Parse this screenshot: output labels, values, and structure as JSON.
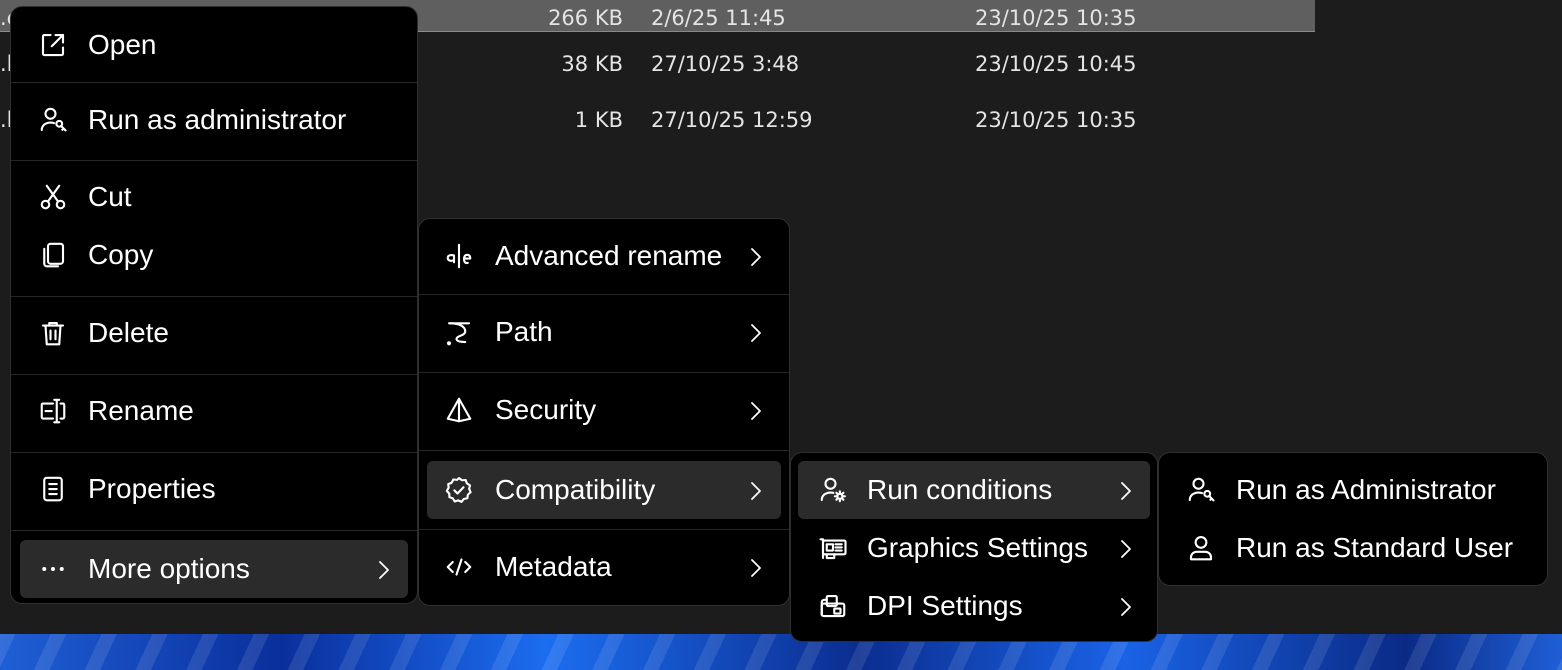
{
  "file_list": {
    "rows": [
      {
        "name": ".exe",
        "size": "266 KB",
        "modified": "2/6/25 11:45",
        "created": "23/10/25 10:35",
        "selected": true
      },
      {
        "name": ".l",
        "size": "38 KB",
        "modified": "27/10/25 3:48",
        "created": "23/10/25 10:45",
        "selected": false
      },
      {
        "name": ".l",
        "size": "1 KB",
        "modified": "27/10/25 12:59",
        "created": "23/10/25 10:35",
        "selected": false
      }
    ]
  },
  "context_menu": {
    "items": [
      {
        "label": "Open",
        "icon": "open-external-icon"
      },
      {
        "label": "Run as administrator",
        "icon": "user-key-icon"
      },
      {
        "label": "Cut",
        "icon": "scissors-icon"
      },
      {
        "label": "Copy",
        "icon": "copy-icon"
      },
      {
        "label": "Delete",
        "icon": "trash-icon"
      },
      {
        "label": "Rename",
        "icon": "rename-icon"
      },
      {
        "label": "Properties",
        "icon": "properties-icon"
      },
      {
        "label": "More options",
        "icon": "more-horizontal-icon",
        "submenu": true,
        "highlighted": true
      }
    ]
  },
  "more_options_menu": {
    "items": [
      {
        "label": "Advanced rename",
        "icon": "text-cursor-icon",
        "submenu": true
      },
      {
        "label": "Path",
        "icon": "path-icon",
        "submenu": true
      },
      {
        "label": "Security",
        "icon": "security-icon",
        "submenu": true
      },
      {
        "label": "Compatibility",
        "icon": "verified-badge-icon",
        "submenu": true,
        "highlighted": true
      },
      {
        "label": "Metadata",
        "icon": "code-icon",
        "submenu": true
      }
    ]
  },
  "compatibility_menu": {
    "items": [
      {
        "label": "Run conditions",
        "icon": "user-settings-icon",
        "submenu": true,
        "highlighted": true
      },
      {
        "label": "Graphics Settings",
        "icon": "graphics-card-icon",
        "submenu": true
      },
      {
        "label": "DPI Settings",
        "icon": "dpi-icon",
        "submenu": true
      }
    ]
  },
  "run_conditions_menu": {
    "items": [
      {
        "label": "Run as Administrator",
        "icon": "user-key-icon"
      },
      {
        "label": "Run as Standard User",
        "icon": "user-icon"
      }
    ]
  },
  "colors": {
    "menu_background": "#000000",
    "highlight": "#2b2b2b",
    "window_background": "#1c1c1c",
    "selected_row": "#5f5f5f",
    "text": "#ffffff"
  }
}
